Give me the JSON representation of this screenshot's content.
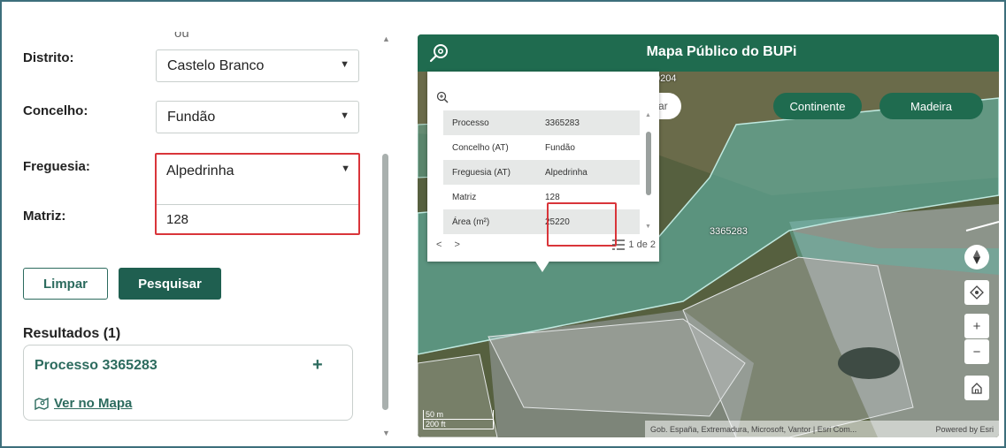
{
  "form": {
    "cut_text": "ou",
    "distrito": {
      "label": "Distrito:",
      "value": "Castelo Branco"
    },
    "concelho": {
      "label": "Concelho:",
      "value": "Fundão"
    },
    "freguesia": {
      "label": "Freguesia:",
      "value": "Alpedrinha"
    },
    "matriz": {
      "label": "Matriz:",
      "value": "128"
    },
    "buttons": {
      "clear": "Limpar",
      "search": "Pesquisar"
    }
  },
  "results": {
    "title": "Resultados (1)",
    "items": [
      {
        "title": "Processo 3365283",
        "expand": "+",
        "link": "Ver no Mapa"
      }
    ]
  },
  "map": {
    "title": "Mapa Público do BUPi",
    "top_label": "0204",
    "partial_button": "ar",
    "region_buttons": [
      "Continente",
      "Madeira"
    ],
    "parcel_label": "3365283",
    "controls": {
      "zoom_in": "+",
      "zoom_out": "−"
    },
    "scale": {
      "metric": "50 m",
      "imperial": "200 ft"
    },
    "attribution": "Gob. España, Extremadura, Microsoft, Vantor | Esri Com...",
    "powered_by": "Powered by Esri",
    "popup": {
      "rows": [
        {
          "key": "Processo",
          "value": "3365283"
        },
        {
          "key": "Concelho (AT)",
          "value": "Fundão"
        },
        {
          "key": "Freguesia (AT)",
          "value": "Alpedrinha"
        },
        {
          "key": "Matriz",
          "value": "128"
        },
        {
          "key": "Área (m²)",
          "value": "25220"
        }
      ],
      "pagination": "1 de 2"
    }
  },
  "colors": {
    "brand_green": "#1f6b4f",
    "highlight_red": "#d9353a",
    "parcel_teal": "#5fb3a4"
  }
}
